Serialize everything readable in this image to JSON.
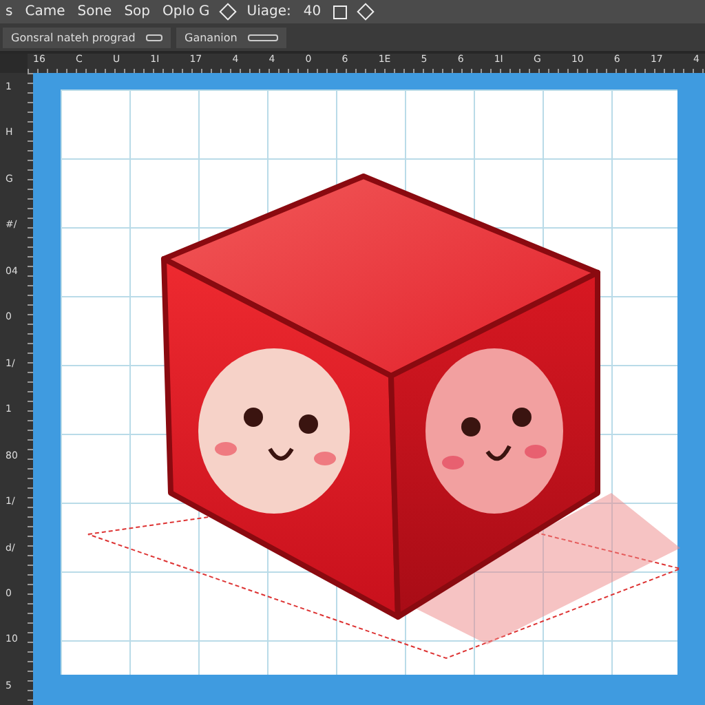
{
  "menu_bar": {
    "items": [
      {
        "label": "s"
      },
      {
        "label": "Came"
      },
      {
        "label": "Sone"
      },
      {
        "label": "Sop"
      },
      {
        "label": "OpIo G"
      },
      {
        "label": "Uiage:"
      },
      {
        "label": "40"
      }
    ]
  },
  "options_bar": {
    "fields": [
      {
        "value": "Gonsral nateh prograd"
      },
      {
        "value": "Gananion"
      }
    ]
  },
  "top_ruler": {
    "labels": [
      "16",
      "C",
      "U",
      "1I",
      "17",
      "4",
      "4",
      "0",
      "6",
      "1E",
      "5",
      "6",
      "1I",
      "G",
      "10",
      "6",
      "17",
      "4"
    ]
  },
  "left_ruler": {
    "labels": [
      "1",
      "H",
      "G",
      "#/",
      "04",
      "0",
      "1/",
      "1",
      "80",
      "1/",
      "d/",
      "0",
      "10",
      "5"
    ]
  }
}
